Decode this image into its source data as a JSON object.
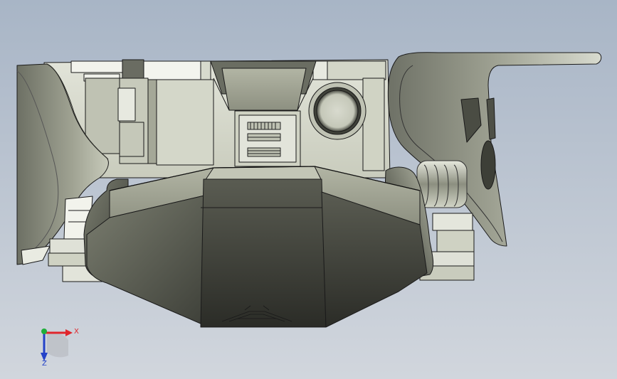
{
  "viewport": {
    "background_top": "#a9b6c7",
    "background_bottom": "#d0d6de"
  },
  "triad": {
    "x_label": "X",
    "z_label": "Z",
    "x_color": "#e0262c",
    "y_color": "#1fae3a",
    "z_color": "#2442c8"
  },
  "model": {
    "shade_light": "#d9dccf",
    "shade_mid": "#a7ab98",
    "shade_dark": "#3a3c35",
    "edge_color": "#1a1a1a"
  }
}
